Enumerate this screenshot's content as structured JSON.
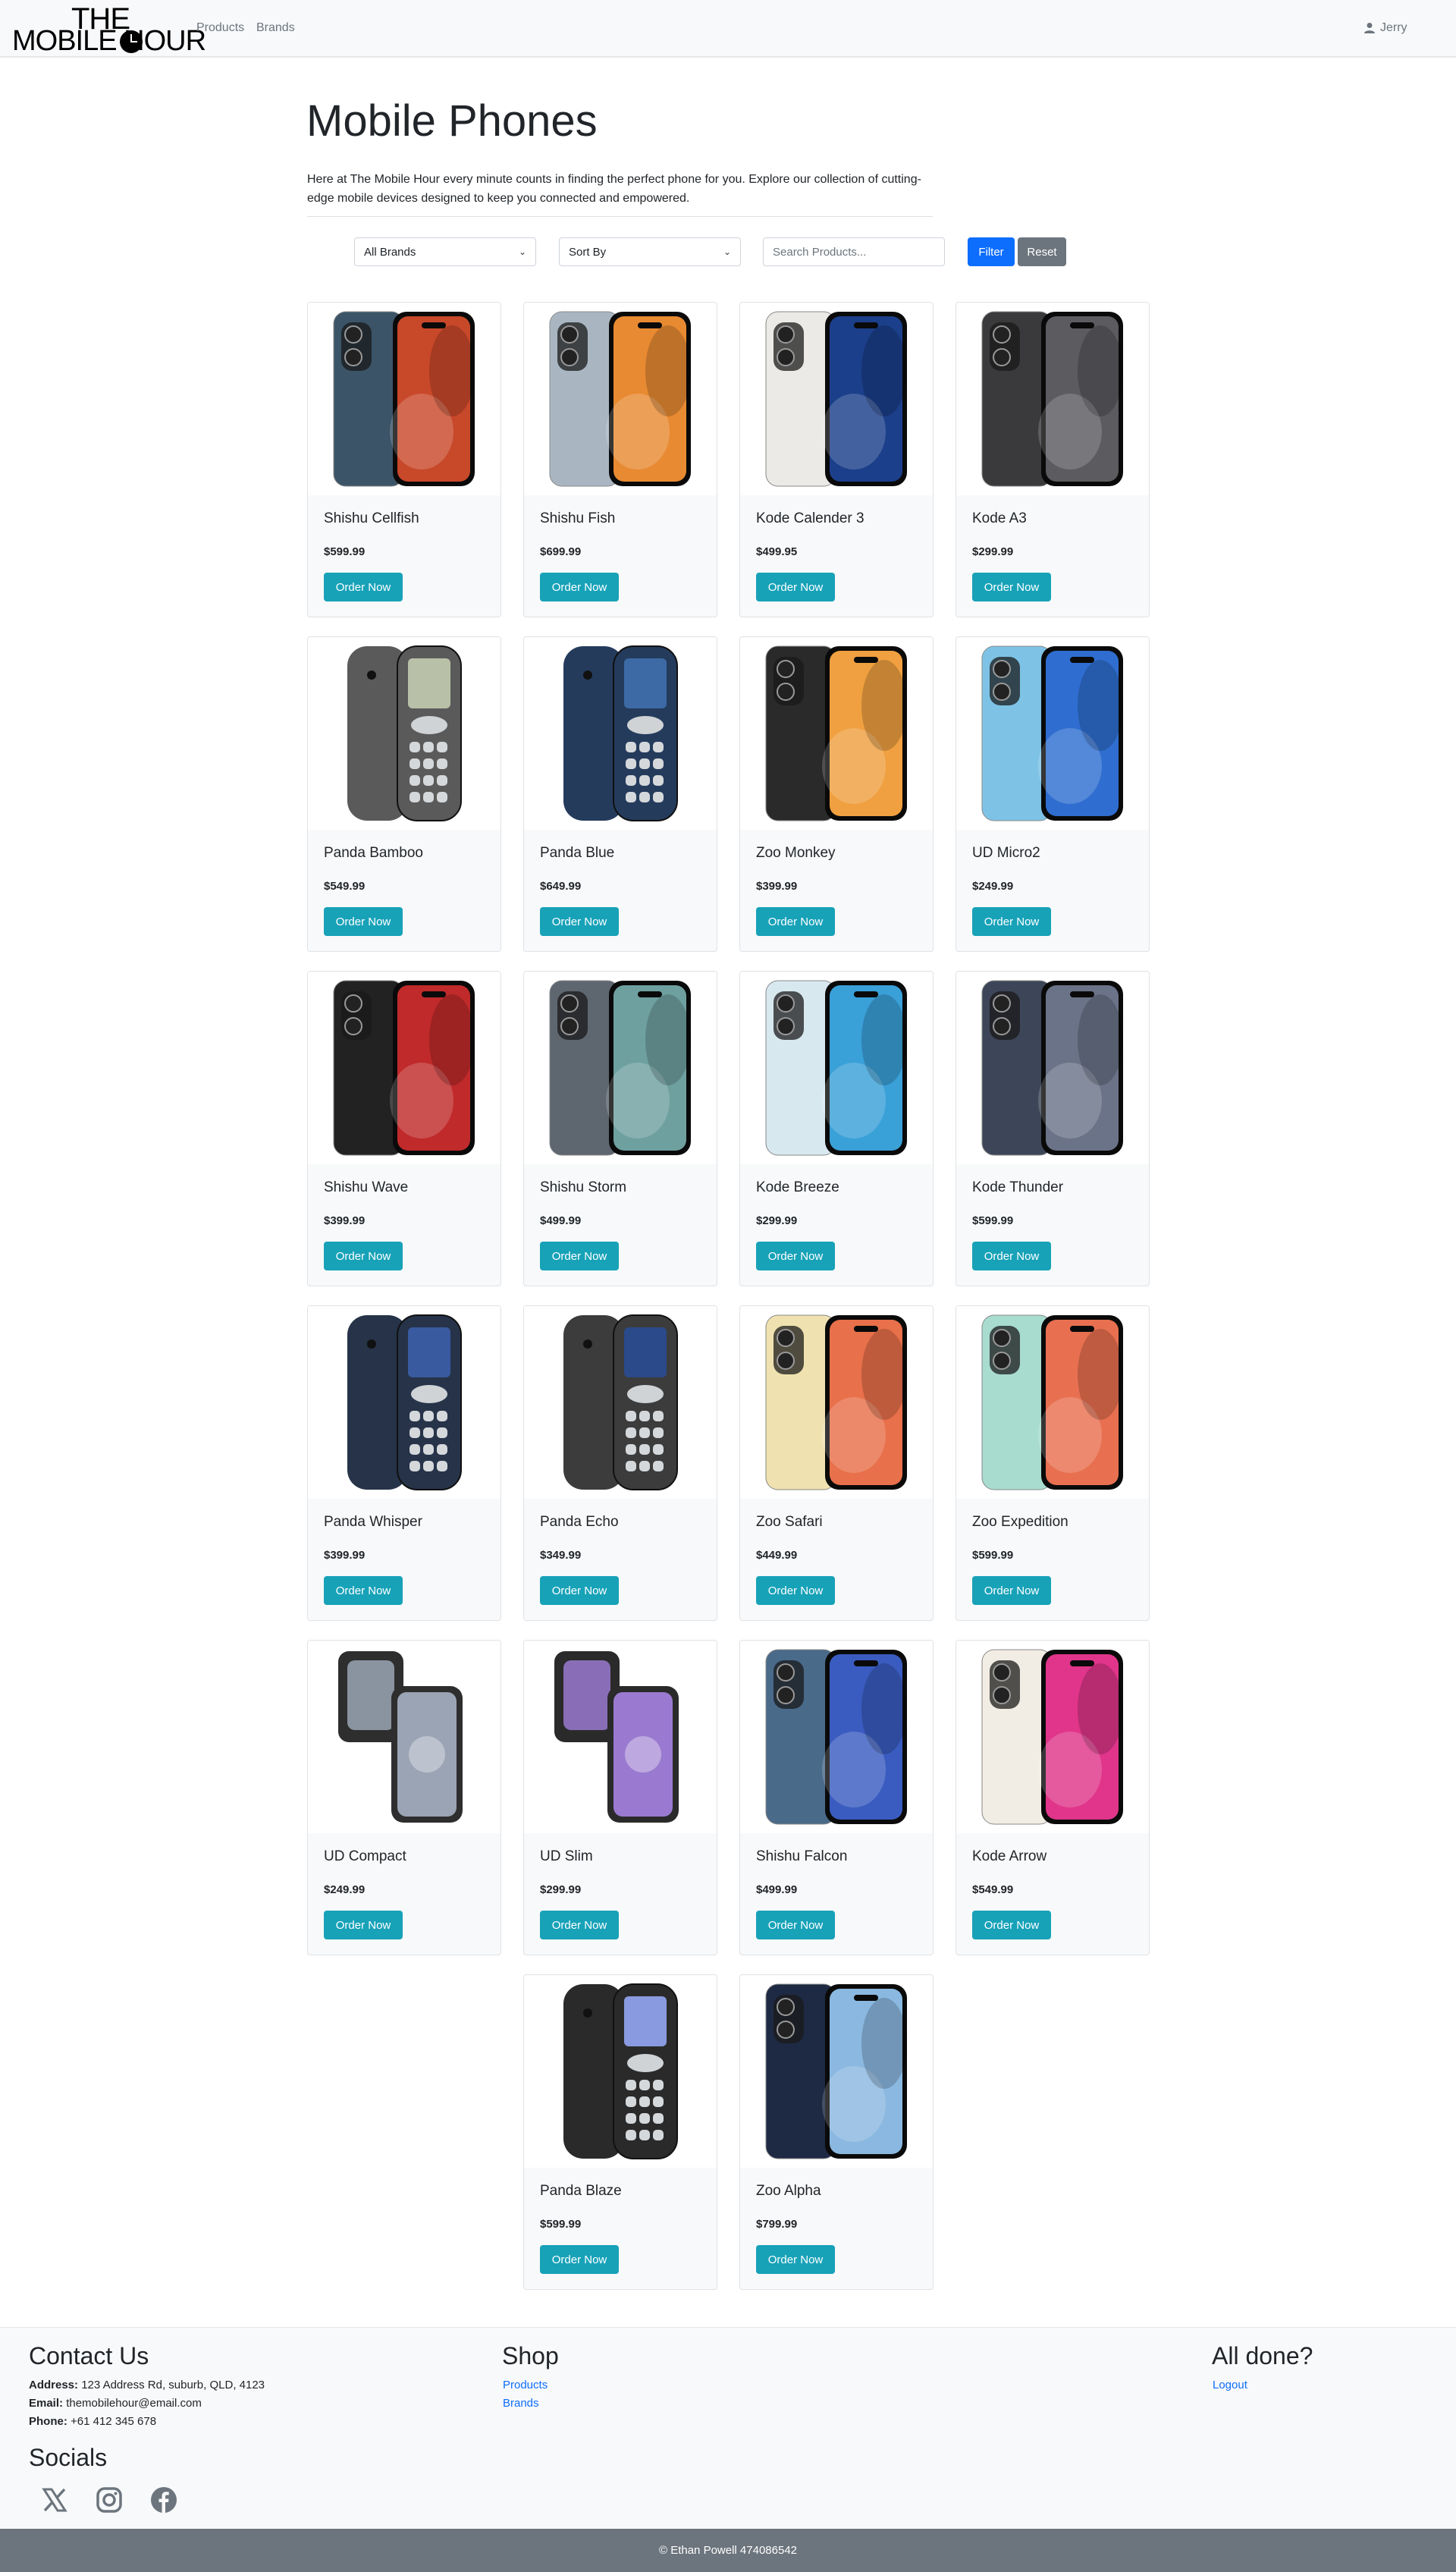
{
  "nav": {
    "logo_line1": "THE",
    "logo_line2": "MOBILE HOUR",
    "links": [
      "Products",
      "Brands"
    ],
    "user": "Jerry"
  },
  "header": {
    "title": "Mobile Phones",
    "intro": "Here at The Mobile Hour every minute counts in finding the perfect phone for you. Explore our collection of cutting-edge mobile devices designed to keep you connected and empowered."
  },
  "filters": {
    "brand_select": "All Brands",
    "sort_select": "Sort By",
    "search_placeholder": "Search Products...",
    "filter_button": "Filter",
    "reset_button": "Reset"
  },
  "products": [
    {
      "name": "Shishu Cellfish",
      "price": "$599.99",
      "cta": "Order Now",
      "body": "#3b5468",
      "screen": "#c8482a",
      "style": "smart"
    },
    {
      "name": "Shishu Fish",
      "price": "$699.99",
      "cta": "Order Now",
      "body": "#a9b6c2",
      "screen": "#e88a32",
      "style": "smart"
    },
    {
      "name": "Kode Calender 3",
      "price": "$499.95",
      "cta": "Order Now",
      "body": "#eceae6",
      "screen": "#1b3f8a",
      "style": "smart"
    },
    {
      "name": "Kode A3",
      "price": "$299.99",
      "cta": "Order Now",
      "body": "#3a3a3c",
      "screen": "#5b5b60",
      "style": "smart"
    },
    {
      "name": "Panda Bamboo",
      "price": "$549.99",
      "cta": "Order Now",
      "body": "#5a5a5a",
      "screen": "#b9c0a8",
      "style": "feature"
    },
    {
      "name": "Panda Blue",
      "price": "$649.99",
      "cta": "Order Now",
      "body": "#243b5c",
      "screen": "#3d6aa5",
      "style": "feature"
    },
    {
      "name": "Zoo Monkey",
      "price": "$399.99",
      "cta": "Order Now",
      "body": "#2a2a2a",
      "screen": "#f0a040",
      "style": "smart"
    },
    {
      "name": "UD Micro2",
      "price": "$249.99",
      "cta": "Order Now",
      "body": "#7ec3e6",
      "screen": "#2f6ed0",
      "style": "smart"
    },
    {
      "name": "Shishu Wave",
      "price": "$399.99",
      "cta": "Order Now",
      "body": "#222222",
      "screen": "#c02a2a",
      "style": "smart"
    },
    {
      "name": "Shishu Storm",
      "price": "$499.99",
      "cta": "Order Now",
      "body": "#5e6670",
      "screen": "#6fa0a0",
      "style": "smart"
    },
    {
      "name": "Kode Breeze",
      "price": "$299.99",
      "cta": "Order Now",
      "body": "#d8e8ef",
      "screen": "#3aa0d8",
      "style": "smart"
    },
    {
      "name": "Kode Thunder",
      "price": "$599.99",
      "cta": "Order Now",
      "body": "#3d4658",
      "screen": "#6b7388",
      "style": "smart"
    },
    {
      "name": "Panda Whisper",
      "price": "$399.99",
      "cta": "Order Now",
      "body": "#263349",
      "screen": "#3a5aa0",
      "style": "feature"
    },
    {
      "name": "Panda Echo",
      "price": "$349.99",
      "cta": "Order Now",
      "body": "#3c3c3c",
      "screen": "#2a4a8a",
      "style": "feature"
    },
    {
      "name": "Zoo Safari",
      "price": "$449.99",
      "cta": "Order Now",
      "body": "#efe2b0",
      "screen": "#e8704a",
      "style": "smart"
    },
    {
      "name": "Zoo Expedition",
      "price": "$599.99",
      "cta": "Order Now",
      "body": "#a8dccf",
      "screen": "#e87050",
      "style": "smart"
    },
    {
      "name": "UD Compact",
      "price": "$249.99",
      "cta": "Order Now",
      "body": "#2e2e2e",
      "screen": "#9aa4b4",
      "style": "flip"
    },
    {
      "name": "UD Slim",
      "price": "$299.99",
      "cta": "Order Now",
      "body": "#2a2a2a",
      "screen": "#9a7ad0",
      "style": "flip"
    },
    {
      "name": "Shishu Falcon",
      "price": "$499.99",
      "cta": "Order Now",
      "body": "#4a6a8a",
      "screen": "#3a5cc0",
      "style": "smart"
    },
    {
      "name": "Kode Arrow",
      "price": "$549.99",
      "cta": "Order Now",
      "body": "#f2ede4",
      "screen": "#e0358a",
      "style": "smart"
    },
    {
      "name": "Panda Blaze",
      "price": "$599.99",
      "cta": "Order Now",
      "body": "#2a2a2a",
      "screen": "#8a9ae0",
      "style": "feature"
    },
    {
      "name": "Zoo Alpha",
      "price": "$799.99",
      "cta": "Order Now",
      "body": "#1e2a44",
      "screen": "#8ab8e0",
      "style": "smart"
    }
  ],
  "footer": {
    "contact_heading": "Contact Us",
    "address_label": "Address:",
    "address": "123 Address Rd, suburb, QLD, 4123",
    "email_label": "Email:",
    "email": "themobilehour@email.com",
    "phone_label": "Phone:",
    "phone": "+61 412 345 678",
    "socials_heading": "Socials",
    "shop_heading": "Shop",
    "shop_links": [
      "Products",
      "Brands"
    ],
    "done_heading": "All done?",
    "logout": "Logout",
    "copyright": "© Ethan Powell 474086542"
  },
  "colors": {
    "primary": "#0d6efd",
    "info": "#17a2b8",
    "secondary": "#6c757d",
    "light": "#f8f9fa"
  }
}
